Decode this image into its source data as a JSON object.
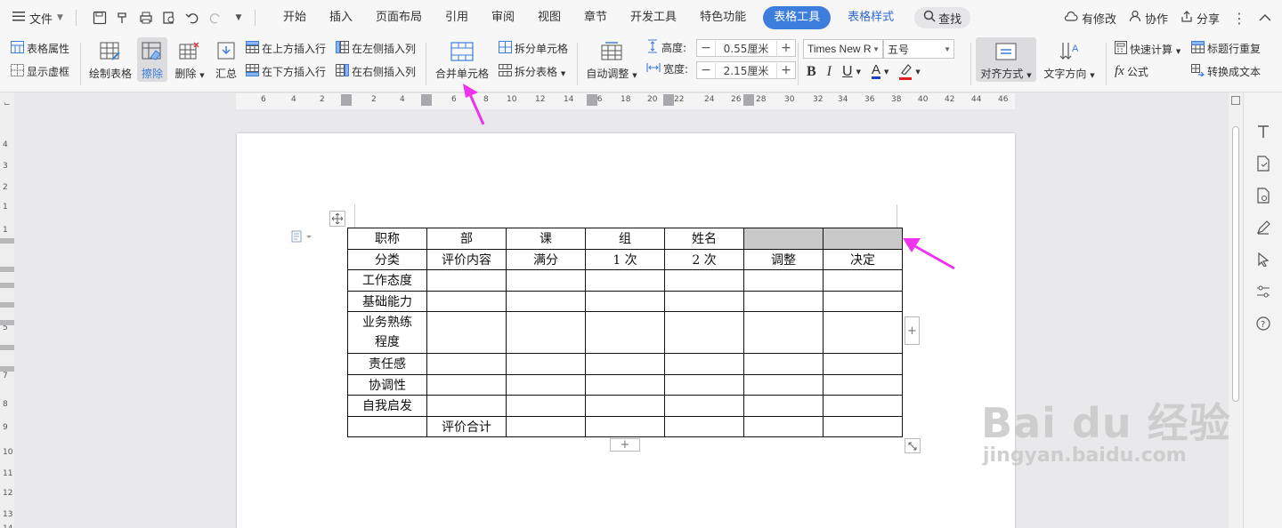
{
  "menu": {
    "file": "文件",
    "tabs": [
      "开始",
      "插入",
      "页面布局",
      "引用",
      "审阅",
      "视图",
      "章节",
      "开发工具",
      "特色功能"
    ],
    "active_tab": "表格工具",
    "secondary_tab": "表格样式",
    "search": "查找",
    "right": {
      "changes": "有修改",
      "collab": "协作",
      "share": "分享"
    }
  },
  "ribbon": {
    "table_props": "表格属性",
    "show_grid": "显示虚框",
    "draw_table": "绘制表格",
    "erase": "擦除",
    "delete": "删除",
    "summary": "汇总",
    "insert_above": "在上方插入行",
    "insert_below": "在下方插入行",
    "insert_left": "在左侧插入列",
    "insert_right": "在右侧插入列",
    "merge_cells": "合并单元格",
    "split_cells": "拆分单元格",
    "split_table": "拆分表格",
    "auto_fit": "自动调整",
    "height_label": "高度:",
    "height_value": "0.55厘米",
    "width_label": "宽度:",
    "width_value": "2.15厘米",
    "font_name": "Times New R",
    "font_size": "五号",
    "align": "对齐方式",
    "text_dir": "文字方向",
    "quick_calc": "快速计算",
    "formula": "公式",
    "repeat_header": "标题行重复",
    "to_text": "转换成文本",
    "accent": "#3d7ddb",
    "font_color": "#1f3fbf",
    "highlight_color": "#e02020"
  },
  "ruler": {
    "h_ticks": [
      "6",
      "4",
      "2",
      "2",
      "4",
      "6",
      "8",
      "10",
      "12",
      "14",
      "16",
      "18",
      "20",
      "22",
      "24",
      "26",
      "28",
      "30",
      "32",
      "34",
      "36",
      "38",
      "40",
      "42",
      "44",
      "46"
    ],
    "v_ticks": [
      "4",
      "3",
      "2",
      "1",
      "1",
      "5",
      "7",
      "8",
      "9",
      "10",
      "11",
      "12",
      "13",
      "14"
    ]
  },
  "table": {
    "rows": [
      [
        "职称",
        "部",
        "课",
        "组",
        "姓名",
        "",
        ""
      ],
      [
        "分类",
        "评价内容",
        "满分",
        "1 次",
        "2 次",
        "调整",
        "决定"
      ],
      [
        "工作态度",
        "",
        "",
        "",
        "",
        "",
        ""
      ],
      [
        "基础能力",
        "",
        "",
        "",
        "",
        "",
        ""
      ],
      [
        "业务熟练程度",
        "",
        "",
        "",
        "",
        "",
        ""
      ],
      [
        "责任感",
        "",
        "",
        "",
        "",
        "",
        ""
      ],
      [
        "协调性",
        "",
        "",
        "",
        "",
        "",
        ""
      ],
      [
        "自我启发",
        "",
        "",
        "",
        "",
        "",
        ""
      ],
      [
        "",
        "评价合计",
        "",
        "",
        "",
        "",
        ""
      ]
    ],
    "highlight_color": "#c9c9c9"
  },
  "watermark": {
    "line1": "Bai du 经验",
    "line2": "jingyan.baidu.com"
  },
  "arrow_color": "#ee33ee"
}
